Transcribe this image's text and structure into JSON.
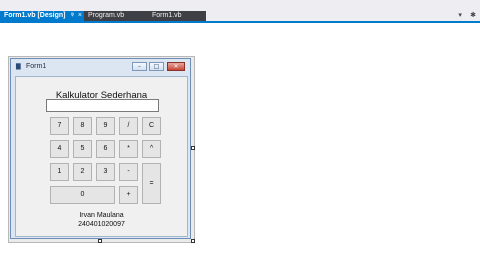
{
  "tabs": [
    {
      "label": "Form1.vb [Design]",
      "pin": "ᵠ",
      "close": "×"
    },
    {
      "label": "Program.vb"
    },
    {
      "label": "Form1.vb"
    }
  ],
  "tab_tools": {
    "dropdown": "▾",
    "settings": "✱"
  },
  "form": {
    "icon": "▇",
    "title": "Form1",
    "minimize": "–",
    "maximize": "□",
    "close": "✕",
    "heading": "Kalkulator Sederhana",
    "display_value": "",
    "buttons": {
      "b7": "7",
      "b8": "8",
      "b9": "9",
      "div": "/",
      "clear": "C",
      "b4": "4",
      "b5": "5",
      "b6": "6",
      "mul": "*",
      "pow": "^",
      "b1": "1",
      "b2": "2",
      "b3": "3",
      "sub": "-",
      "eq": "=",
      "b0": "0",
      "add": "+"
    },
    "footer_name": "Irvan Maulana",
    "footer_id": "240401020097"
  },
  "colors": {
    "accent": "#007acc",
    "tab_inactive": "#3f3f46"
  }
}
